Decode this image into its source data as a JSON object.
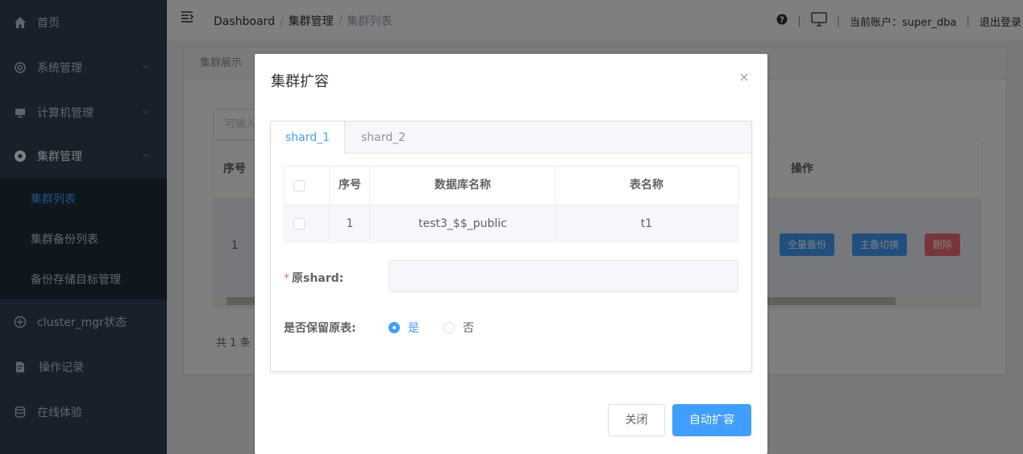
{
  "sidebar": {
    "items": [
      {
        "label": "首页",
        "icon": "home-icon"
      },
      {
        "label": "系统管理",
        "icon": "gear-icon"
      },
      {
        "label": "计算机管理",
        "icon": "monitor-icon"
      },
      {
        "label": "集群管理",
        "icon": "cluster-icon"
      },
      {
        "label": "cluster_mgr状态",
        "icon": "status-icon"
      },
      {
        "label": "操作记录",
        "icon": "log-icon"
      },
      {
        "label": "在线体验",
        "icon": "database-icon"
      }
    ],
    "submenu": [
      "集群列表",
      "集群备份列表",
      "备份存储目标管理"
    ]
  },
  "header": {
    "breadcrumb": [
      "Dashboard",
      "集群管理",
      "集群列表"
    ],
    "separator": "/",
    "account_label": "当前账户：super_dba",
    "logout_label": "退出登录",
    "divider": "|"
  },
  "background": {
    "tabs": [
      "集群展示"
    ],
    "search_placeholder": "可输入",
    "columns": [
      "序号",
      "操作"
    ],
    "row_index": "1",
    "actions": [
      "全量备份",
      "主备切换",
      "删除"
    ],
    "total": "共 1 条"
  },
  "modal": {
    "title": "集群扩容",
    "tabs": [
      "shard_1",
      "shard_2"
    ],
    "table": {
      "columns": [
        "序号",
        "数据库名称",
        "表名称"
      ],
      "rows": [
        {
          "index": "1",
          "database": "test3_$$_public",
          "table": "t1"
        }
      ]
    },
    "source_shard_label": "原shard:",
    "required_mark": "*",
    "keep_table_label": "是否保留原表:",
    "radio_yes": "是",
    "radio_no": "否",
    "close_button": "关闭",
    "confirm_button": "自动扩容"
  },
  "colors": {
    "primary": "#409eff",
    "danger": "#f56c6c",
    "sidebar_bg": "#304156"
  }
}
